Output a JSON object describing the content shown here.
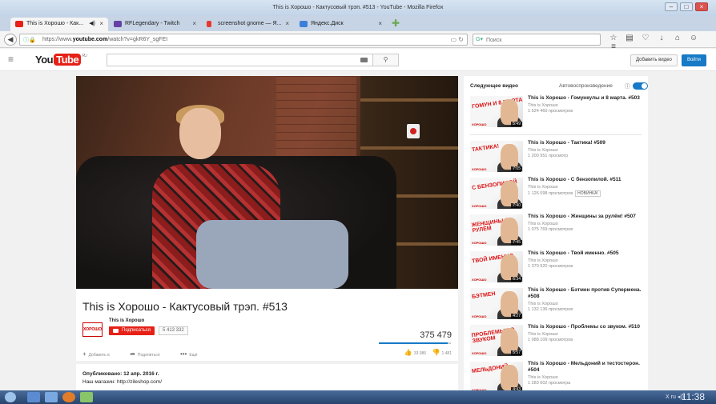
{
  "window": {
    "title": "This is Хорошо - Кактусовый трэп. #513 - YouTube - Mozilla Firefox"
  },
  "tabs": [
    {
      "label": "This is Хорошо - Как...",
      "active": true,
      "color": "#e62117"
    },
    {
      "label": "RFLegendary - Twitch",
      "active": false,
      "color": "#6441a4"
    },
    {
      "label": "screenshot gnome — Я...",
      "active": false,
      "color": "#e8372c"
    },
    {
      "label": "Яндекс.Диск",
      "active": false,
      "color": "#3d7fd8"
    }
  ],
  "nav": {
    "url_prefix": "https://www.",
    "url_domain": "youtube.com",
    "url_path": "/watch?v=gkR6Y_sgFEI",
    "search_placeholder": "Поиск"
  },
  "youtube_header": {
    "logo_you": "You",
    "logo_tube": "Tube",
    "logo_region": "RU",
    "add_video": "Добавить видео",
    "login": "Войти"
  },
  "video": {
    "title": "This is Хорошо - Кактусовый трэп. #513",
    "channel_name": "This is Хорошо",
    "channel_logo_text": "ХОРОШО",
    "subscribe_label": "Подписаться",
    "subscriber_count": "5 413 332",
    "view_count": "375 479",
    "like_ratio": 0.96,
    "actions": {
      "add": "Добавить в",
      "share": "Поделиться",
      "more": "Ещё"
    },
    "likes": "33 086",
    "dislikes": "1 481",
    "published": "Опубликовано: 12 апр. 2016 г.",
    "shop": "Наш магазин: http://zileshop.com/"
  },
  "sidebar": {
    "next_label": "Следующее видео",
    "autoplay_label": "Автовоспроизведение",
    "items": [
      {
        "title": "This is Хорошо - Гомункулы и 8 марта. #503",
        "channel": "This is Хорошо",
        "views": "1 524 460 просмотров",
        "duration": "5:49",
        "thumb_text": "ГОМУН И 8 МАРТА"
      },
      {
        "title": "This is Хорошо - Тактика! #509",
        "channel": "This is Хорошо",
        "views": "1 200 951 просмотр",
        "duration": "7:05",
        "thumb_text": "ТАКТИКА!"
      },
      {
        "title": "This is Хорошо - С бензопилой. #511",
        "channel": "This is Хорошо",
        "views": "1 126 098 просмотров",
        "duration": "7:40",
        "badge": "НОВИНКА!",
        "thumb_text": "С БЕНЗОПИЛОЙ"
      },
      {
        "title": "This is Хорошо - Женщины за рулём! #507",
        "channel": "This is Хорошо",
        "views": "1 075 769 просмотров",
        "duration": "7:45",
        "thumb_text": "ЖЕНЩИНЫ ЗА РУЛЁМ"
      },
      {
        "title": "This is Хорошо - Твой именно. #505",
        "channel": "This is Хорошо",
        "views": "1 370 920 просмотров",
        "duration": "6:34",
        "thumb_text": "ТВОЙ ИМЕННО"
      },
      {
        "title": "This is Хорошо - Бэтмен против Супермена. #508",
        "channel": "This is Хорошо",
        "views": "1 132 136 просмотров",
        "duration": "4:27",
        "thumb_text": "БЭТМЕН"
      },
      {
        "title": "This is Хорошо - Проблемы со звуком. #510",
        "channel": "This is Хорошо",
        "views": "1 088 109 просмотров",
        "duration": "5:57",
        "thumb_text": "ПРОБЛЕМЫ СО ЗВУКОМ"
      },
      {
        "title": "This is Хорошо - Мельдоний и тестостерон. #504",
        "channel": "This is Хорошо",
        "views": "1 283 602 просмотра",
        "duration": "4:43",
        "thumb_text": "МЕЛЬДОНИЙ"
      }
    ]
  },
  "taskbar": {
    "clock": "11:38",
    "tray": "X  ru  ◂))"
  }
}
